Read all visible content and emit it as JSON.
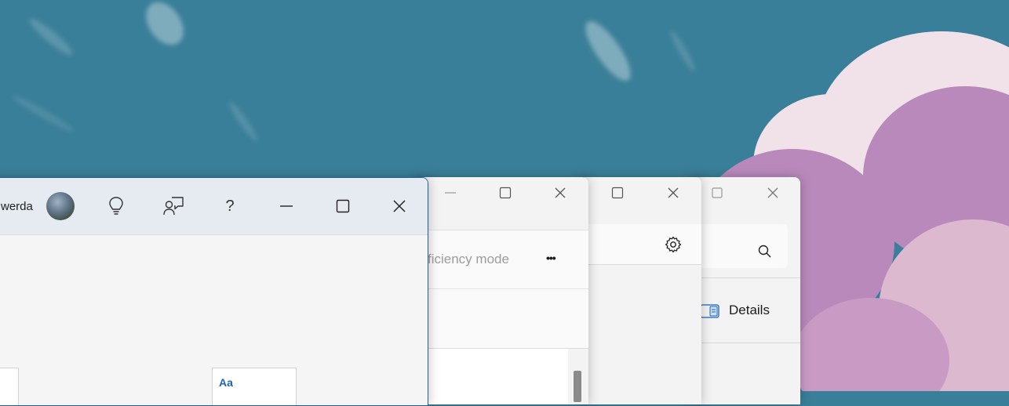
{
  "colors": {
    "wallpaper_sky": "#3a7f99",
    "active_window_border": "#1e5fae",
    "titlebar_active": "#e6ebf1",
    "window_bg": "#f3f3f3",
    "accent_text": "#1a66b8"
  },
  "word_window": {
    "user_name_fragment": "werda",
    "icons": [
      "avatar",
      "lightbulb-icon",
      "comment-person-icon",
      "help-icon",
      "minimize-icon",
      "maximize-icon",
      "close-icon"
    ],
    "help_glyph": "?",
    "style_tile_label": "Aa"
  },
  "task_manager_window": {
    "efficiency_mode_fragment": "ficiency mode",
    "more_glyph": "•••"
  },
  "settings_window": {
    "icons": [
      "gear-icon"
    ]
  },
  "explorer_window": {
    "details_label": "Details",
    "icons": [
      "search-icon",
      "details-pane-icon"
    ]
  }
}
